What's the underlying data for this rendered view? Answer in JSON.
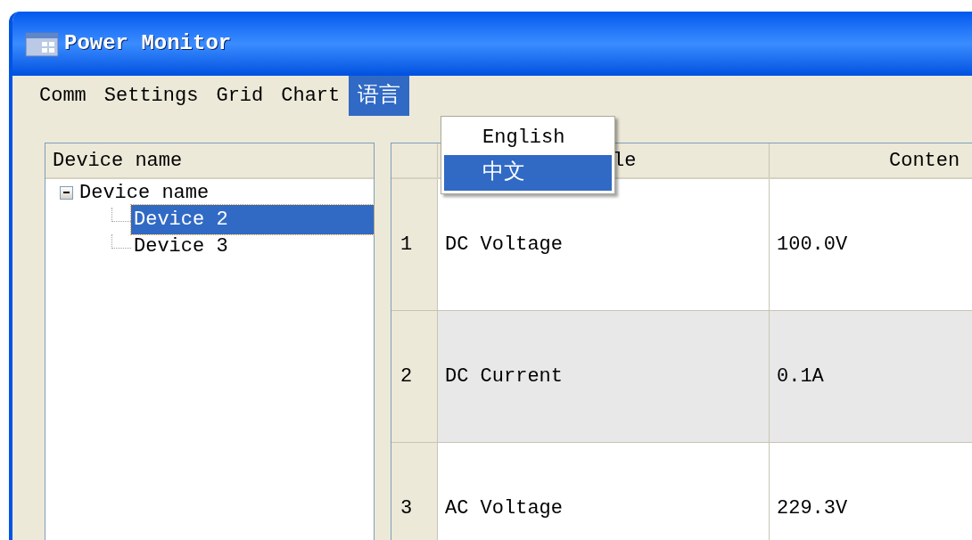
{
  "window": {
    "title": "Power Monitor"
  },
  "menu": [
    {
      "label": "Comm",
      "selected": false
    },
    {
      "label": "Settings",
      "selected": false
    },
    {
      "label": "Grid",
      "selected": false
    },
    {
      "label": "Chart",
      "selected": false
    },
    {
      "label": "语言",
      "selected": true
    }
  ],
  "dropdown": [
    {
      "label": "English",
      "selected": false
    },
    {
      "label": "中文",
      "selected": true
    }
  ],
  "tree": {
    "header": "Device name",
    "items": [
      {
        "label": "Device name",
        "expanded": true,
        "selected": false,
        "children": [
          {
            "label": "Device 2",
            "selected": true
          },
          {
            "label": "Device 3",
            "selected": false
          }
        ]
      }
    ]
  },
  "table": {
    "columns": [
      "le",
      "Conten"
    ],
    "rows": [
      {
        "number": "1",
        "cells": [
          "DC Voltage",
          "100.0V"
        ]
      },
      {
        "number": "2",
        "cells": [
          "DC Current",
          "0.1A"
        ]
      },
      {
        "number": "3",
        "cells": [
          "AC Voltage",
          "229.3V"
        ]
      }
    ]
  }
}
